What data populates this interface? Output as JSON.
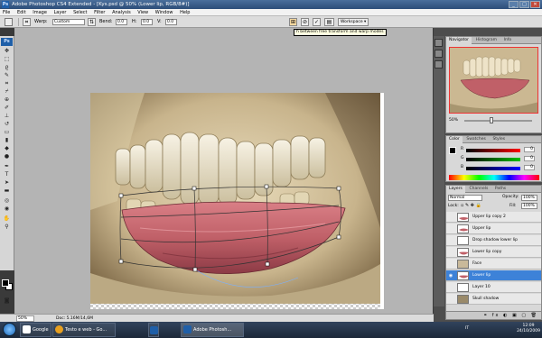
{
  "window": {
    "app_icon": "Ps",
    "title": "Adobe Photoshop CS4 Extended - [Kys.psd @ 50% (Lower lip, RGB/8#)]",
    "controls": [
      "_",
      "□",
      "✕"
    ]
  },
  "menu": [
    "File",
    "Edit",
    "Image",
    "Layer",
    "Select",
    "Filter",
    "Analysis",
    "View",
    "Window",
    "Help"
  ],
  "options": {
    "warp_label": "Warp:",
    "warp_value": "Custom",
    "bend_label": "Bend:",
    "bend_value": "0.0",
    "h_label": "H:",
    "h_value": "0.0",
    "v_label": "V:",
    "v_value": "0.0",
    "workspace": "Workspace ▾",
    "tooltip": "h between free transform and warp modes"
  },
  "toolbox": {
    "ps_logo": "Ps"
  },
  "status": {
    "zoom": "50%",
    "doc": "Doc: 5.16M/14,6M"
  },
  "navigator": {
    "tabs": [
      "Navigator",
      "Histogram",
      "Info"
    ],
    "zoom": "50%"
  },
  "color": {
    "tabs": [
      "Color",
      "Swatches",
      "Styles"
    ],
    "channels": [
      {
        "label": "R",
        "value": "0",
        "color": "#ff0000"
      },
      {
        "label": "G",
        "value": "0",
        "color": "#00c000"
      },
      {
        "label": "B",
        "value": "0",
        "color": "#0000ff"
      }
    ]
  },
  "layers": {
    "tabs": [
      "Layers",
      "Channels",
      "Paths"
    ],
    "blend_mode": "Normal",
    "opacity_label": "Opacity:",
    "opacity": "100%",
    "lock_label": "Lock:",
    "fill_label": "Fill:",
    "fill": "100%",
    "items": [
      {
        "name": "Upper lip copy 2",
        "visible": false,
        "selected": false
      },
      {
        "name": "Upper lip",
        "visible": false,
        "selected": false
      },
      {
        "name": "Drop shadow lower lip",
        "visible": false,
        "selected": false
      },
      {
        "name": "Lower lip copy",
        "visible": false,
        "selected": false
      },
      {
        "name": "Face",
        "visible": false,
        "selected": false
      },
      {
        "name": "Lower lip",
        "visible": true,
        "selected": true
      },
      {
        "name": "Layer 10",
        "visible": false,
        "selected": false
      },
      {
        "name": "Skull shadow",
        "visible": false,
        "selected": false
      }
    ]
  },
  "taskbar": {
    "items": [
      {
        "label": "Google",
        "color": "#ffffff"
      },
      {
        "label": "Testo e web - Go...",
        "color": "#e8a020"
      },
      {
        "label": "Adobe Photosh...",
        "color": "#1f5fa8"
      }
    ],
    "language": "IT",
    "time": "12:09",
    "date": "24/10/2009"
  }
}
